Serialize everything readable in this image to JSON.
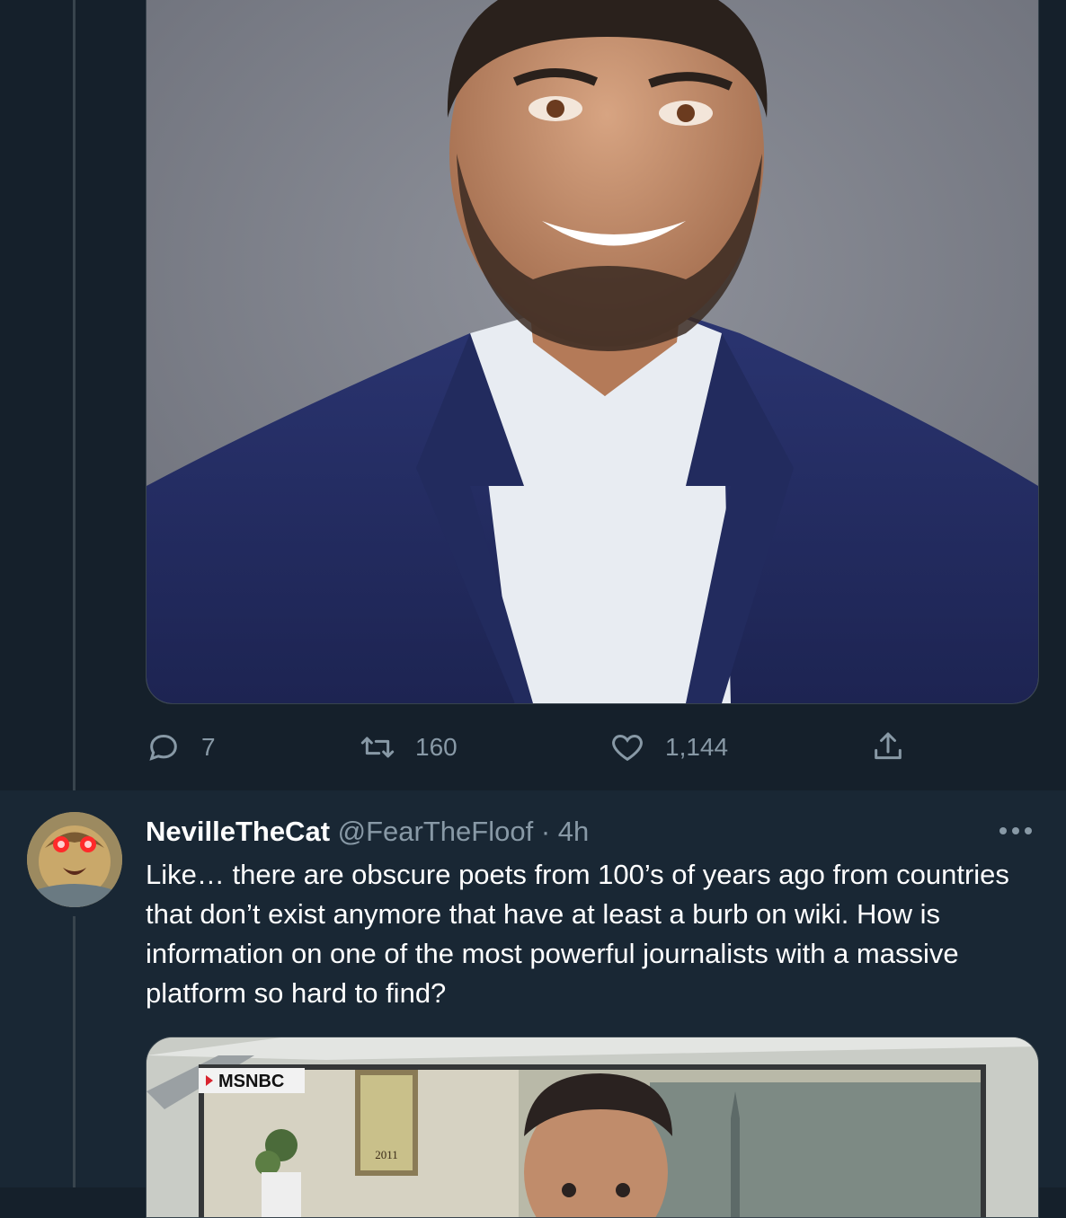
{
  "tweet1": {
    "stats": {
      "replies": "7",
      "retweets": "160",
      "likes": "1,144"
    }
  },
  "tweet2": {
    "display_name": "NevilleTheCat",
    "handle": "@FearTheFloof",
    "separator": "·",
    "time": "4h",
    "text": "Like… there are obscure poets from 100’s of years ago from countries that don’t exist anymore that have at least a burb on wiki. How is information on one of the most powerful journalists with a massive platform so hard to find?",
    "media": {
      "network_label": "MSNBC",
      "poster_year": "2011"
    }
  },
  "icons": {
    "reply": "reply-icon",
    "retweet": "retweet-icon",
    "like": "heart-icon",
    "share": "share-icon",
    "more": "more-icon"
  },
  "colors": {
    "background": "#15202b",
    "reply_background": "#192734",
    "secondary_text": "#8899a6",
    "border": "#38444d"
  }
}
